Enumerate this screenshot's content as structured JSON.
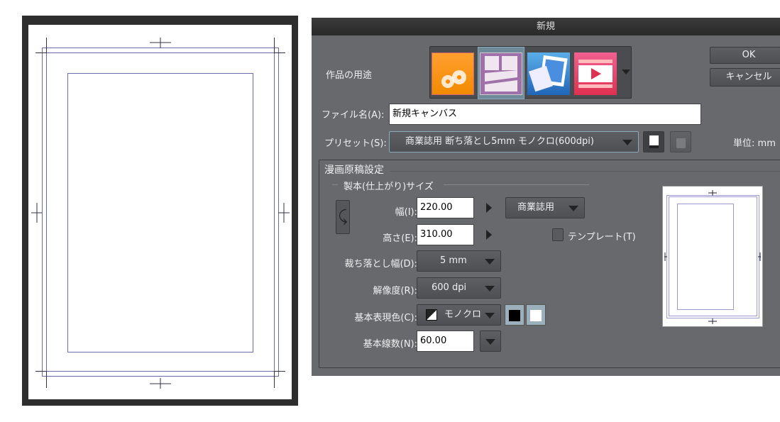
{
  "dialog": {
    "title": "新規",
    "ok": "OK",
    "cancel": "キャンセル"
  },
  "purpose": {
    "label": "作品の用途",
    "icons": [
      "illustration-icon",
      "comic-icon",
      "photo-icon",
      "animation-icon"
    ],
    "selected": 1
  },
  "filename": {
    "label": "ファイル名(A):",
    "value": "新規キャンバス"
  },
  "preset": {
    "label": "プリセット(S):",
    "value": "商業誌用 断ち落とし5mm モノクロ(600dpi)",
    "unit_label": "単位:",
    "unit_value": "mm"
  },
  "manga": {
    "section_label": "漫画原稿設定",
    "size_label": "製本(仕上がり)サイズ",
    "width_label": "幅(I):",
    "width_value": "220.00",
    "height_label": "高さ(E):",
    "height_value": "310.00",
    "size_preset": "商業誌用",
    "template_label": "テンプレート(T)",
    "bleed_label": "裁ち落とし幅(D):",
    "bleed_value": "5 mm",
    "resolution_label": "解像度(R):",
    "resolution_value": "600 dpi",
    "color_label": "基本表現色(C):",
    "color_value": "モノクロ",
    "lines_label": "基本線数(N):",
    "lines_value": "60.00"
  },
  "colors": {
    "accent": "#7a7ab0",
    "dialog_bg": "#68696d"
  }
}
